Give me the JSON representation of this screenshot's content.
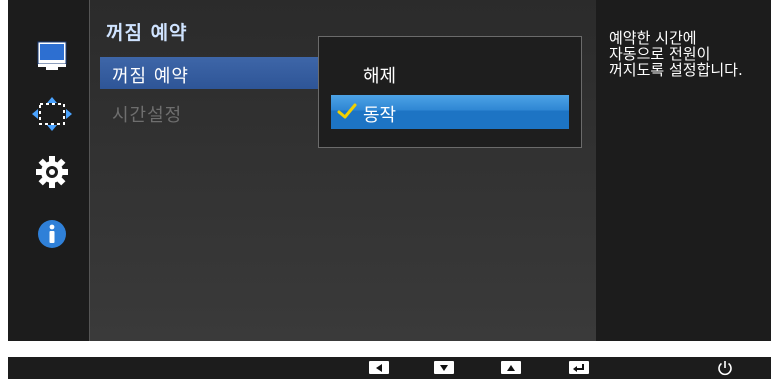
{
  "menu": {
    "title": "꺼짐 예약",
    "items": [
      {
        "label": "꺼짐 예약",
        "selected": true
      },
      {
        "label": "시간설정",
        "selected": false
      }
    ]
  },
  "submenu": {
    "options": [
      {
        "label": "해제",
        "checked": false
      },
      {
        "label": "동작",
        "checked": true
      }
    ]
  },
  "help": {
    "text": "예약한 시간에\n자동으로 전원이\n꺼지도록 설정합니다."
  },
  "nav_icons": [
    "monitor-icon",
    "position-arrows-icon",
    "gear-icon",
    "info-icon"
  ],
  "footer_keys": [
    "left-arrow-icon",
    "down-arrow-icon",
    "up-arrow-icon",
    "enter-icon",
    "power-icon"
  ],
  "colors": {
    "highlight_blue": "#2e5597",
    "option_blue": "#1d74c4",
    "check_yellow": "#f1d000",
    "title_text": "#cfe3ff",
    "disabled_text": "#6e6e6e"
  }
}
